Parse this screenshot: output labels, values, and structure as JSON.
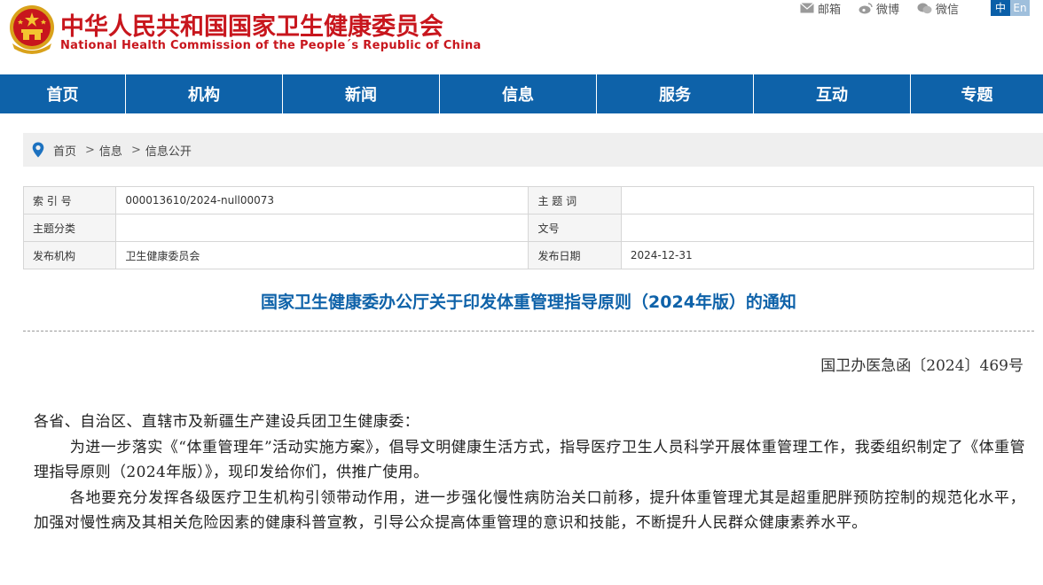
{
  "header": {
    "title_cn": "中华人民共和国国家卫生健康委员会",
    "title_en": "National Health Commission of the People´s Republic of China",
    "tools": [
      {
        "icon": "mail-icon",
        "label": "邮箱"
      },
      {
        "icon": "weibo-icon",
        "label": "微博"
      },
      {
        "icon": "wechat-icon",
        "label": "微信"
      }
    ],
    "lang": {
      "zh": "中",
      "en": "En"
    }
  },
  "nav": {
    "items": [
      {
        "label": "首页"
      },
      {
        "label": "机构"
      },
      {
        "label": "新闻"
      },
      {
        "label": "信息"
      },
      {
        "label": "服务"
      },
      {
        "label": "互动"
      },
      {
        "label": "专题"
      }
    ]
  },
  "breadcrumb": {
    "items": [
      "首页",
      "信息",
      "信息公开"
    ],
    "separator": ">"
  },
  "meta": {
    "rows": [
      {
        "k1": "索 引 号",
        "v1": "000013610/2024-null00073",
        "k2": "主 题 词",
        "v2": ""
      },
      {
        "k1": "主题分类",
        "v1": "",
        "k2": "文号",
        "v2": ""
      },
      {
        "k1": "发布机构",
        "v1": "卫生健康委员会",
        "k2": "发布日期",
        "v2": "2024-12-31"
      }
    ]
  },
  "article": {
    "title": "国家卫生健康委办公厅关于印发体重管理指导原则（2024年版）的通知",
    "doc_number": "国卫办医急函〔2024〕469号",
    "salutation": "各省、自治区、直辖市及新疆生产建设兵团卫生健康委：",
    "paragraphs": [
      "为进一步落实《“体重管理年”活动实施方案》，倡导文明健康生活方式，指导医疗卫生人员科学开展体重管理工作，我委组织制定了《体重管理指导原则（2024年版）》，现印发给你们，供推广使用。",
      "各地要充分发挥各级医疗卫生机构引领带动作用，进一步强化慢性病防治关口前移，提升体重管理尤其是超重肥胖预防控制的规范化水平，加强对慢性病及其相关危险因素的健康科普宣教，引导公众提高体重管理的意识和技能，不断提升人民群众健康素养水平。"
    ]
  },
  "colors": {
    "brand_red": "#c8161d",
    "nav_blue": "#0e62a9",
    "title_blue": "#0e62a9"
  }
}
